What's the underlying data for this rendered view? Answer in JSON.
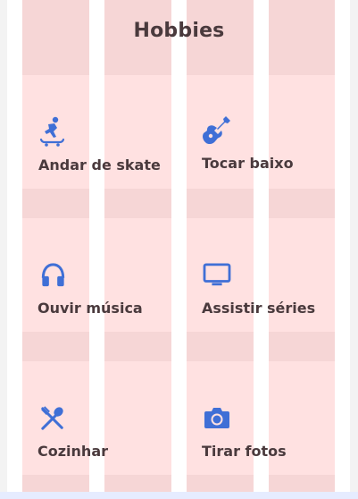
{
  "page": {
    "title": "Hobbies"
  },
  "hobbies": [
    {
      "label": "Andar de skate",
      "icon": "skateboarding-icon"
    },
    {
      "label": "Tocar baixo",
      "icon": "guitar-icon"
    },
    {
      "label": "Ouvir música",
      "icon": "headphones-icon"
    },
    {
      "label": "Assistir séries",
      "icon": "tv-icon"
    },
    {
      "label": "Cozinhar",
      "icon": "utensils-icon"
    },
    {
      "label": "Tirar fotos",
      "icon": "camera-icon"
    }
  ],
  "colors": {
    "icon": "#3f6fd6",
    "text": "#4a3a3d",
    "grid_column": "#f6d6d6",
    "card": "#ffe1e1",
    "gutter": "#f3f3f3"
  }
}
